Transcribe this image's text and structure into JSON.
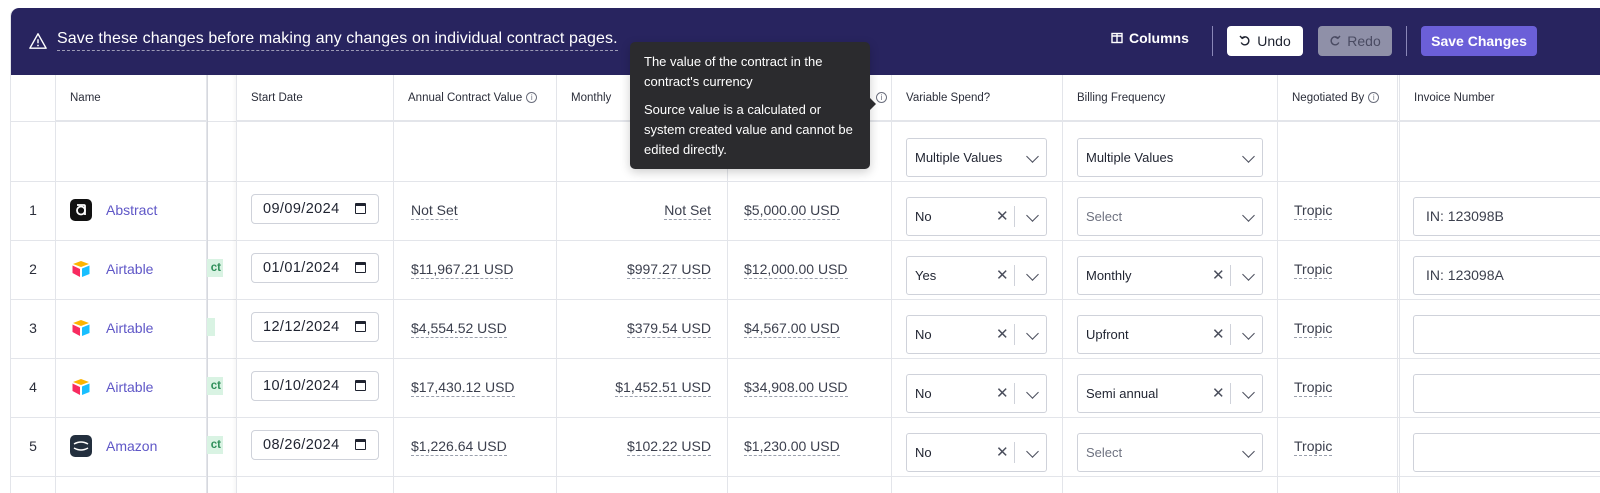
{
  "banner": {
    "message": "Save these changes before making any changes on individual contract pages.",
    "columns_label": "Columns",
    "undo_label": "Undo",
    "redo_label": "Redo",
    "save_label": "Save Changes"
  },
  "tooltip": {
    "line1": "The value of the contract in the contract's currency",
    "line2": "Source value is a calculated or system created value and cannot be edited directly."
  },
  "headers": {
    "name": "Name",
    "start_date": "Start Date",
    "annual_value": "Annual Contract Value",
    "monthly": "Monthly",
    "variable_spend": "Variable Spend?",
    "billing_frequency": "Billing Frequency",
    "negotiated_by": "Negotiated By",
    "invoice_number": "Invoice Number"
  },
  "filters": {
    "variable_spend": "Multiple Values",
    "billing_frequency": "Multiple Values"
  },
  "rows": [
    {
      "num": "1",
      "name": "Abstract",
      "tag": "",
      "start_date": "09/09/2024",
      "annual": "Not Set",
      "monthly": "Not Set",
      "value": "$5,000.00 USD",
      "variable": "No",
      "billing": "Select",
      "negotiated": "Tropic",
      "invoice": "IN: 123098B"
    },
    {
      "num": "2",
      "name": "Airtable",
      "tag": "ct",
      "start_date": "01/01/2024",
      "annual": "$11,967.21 USD",
      "monthly": "$997.27 USD",
      "value": "$12,000.00 USD",
      "variable": "Yes",
      "billing": "Monthly",
      "negotiated": "Tropic",
      "invoice": "IN: 123098A"
    },
    {
      "num": "3",
      "name": "Airtable",
      "tag": "",
      "start_date": "12/12/2024",
      "annual": "$4,554.52 USD",
      "monthly": "$379.54 USD",
      "value": "$4,567.00 USD",
      "variable": "No",
      "billing": "Upfront",
      "negotiated": "Tropic",
      "invoice": ""
    },
    {
      "num": "4",
      "name": "Airtable",
      "tag": "ct",
      "start_date": "10/10/2024",
      "annual": "$17,430.12 USD",
      "monthly": "$1,452.51 USD",
      "value": "$34,908.00 USD",
      "variable": "No",
      "billing": "Semi annual",
      "negotiated": "Tropic",
      "invoice": ""
    },
    {
      "num": "5",
      "name": "Amazon",
      "tag": "ct",
      "start_date": "08/26/2024",
      "annual": "$1,226.64 USD",
      "monthly": "$102.22 USD",
      "value": "$1,230.00 USD",
      "variable": "No",
      "billing": "Select",
      "negotiated": "Tropic",
      "invoice": ""
    }
  ],
  "colors": {
    "banner_bg": "#28245f",
    "accent": "#6b5fd8",
    "link": "#5f57c7",
    "tag_bg": "#d9f3e3"
  }
}
